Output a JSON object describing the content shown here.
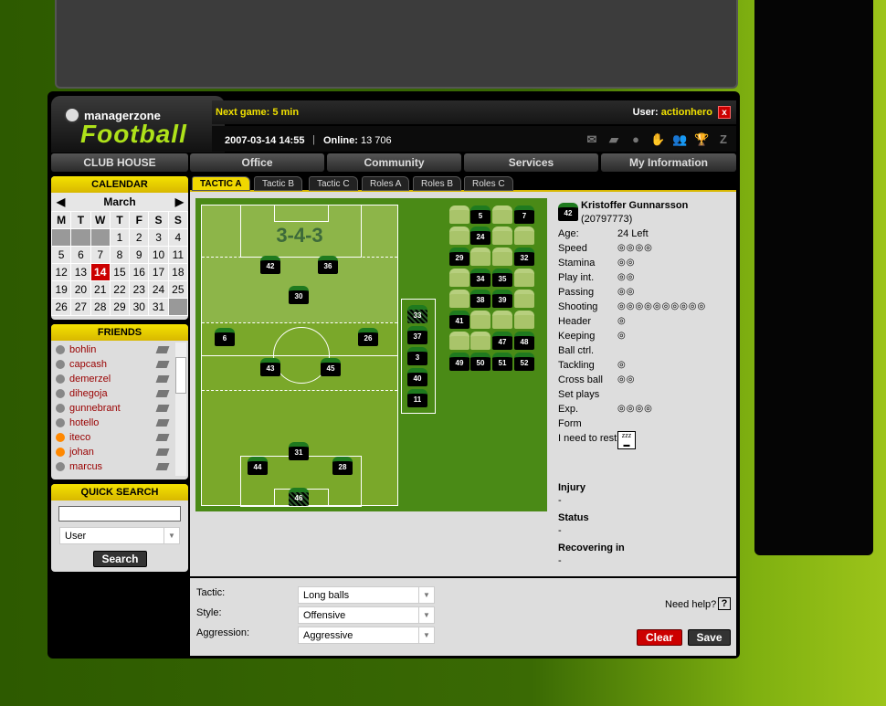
{
  "brand": {
    "top": "managerzone",
    "main": "Football"
  },
  "header": {
    "next_game": "Next game: 5 min",
    "user_label": "User:",
    "username": "actionhero",
    "datetime": "2007-03-14 14:55",
    "online_label": "Online:",
    "online_count": "13 706",
    "icons": [
      "mail-icon",
      "book-icon",
      "ball-icon",
      "hand-icon",
      "people-icon",
      "trophy-icon",
      "z-icon"
    ]
  },
  "nav": [
    "CLUB HOUSE",
    "Office",
    "Community",
    "Services",
    "My Information"
  ],
  "calendar": {
    "title": "CALENDAR",
    "month": "March",
    "weekdays": [
      "M",
      "T",
      "W",
      "T",
      "F",
      "S",
      "S"
    ],
    "weeks": [
      [
        "",
        "",
        "",
        "1",
        "2",
        "3",
        "4"
      ],
      [
        "5",
        "6",
        "7",
        "8",
        "9",
        "10",
        "11"
      ],
      [
        "12",
        "13",
        "14",
        "15",
        "16",
        "17",
        "18"
      ],
      [
        "19",
        "20",
        "21",
        "22",
        "23",
        "24",
        "25"
      ],
      [
        "26",
        "27",
        "28",
        "29",
        "30",
        "31",
        ""
      ]
    ],
    "today": "14"
  },
  "friends": {
    "title": "FRIENDS",
    "items": [
      {
        "name": "bohlin",
        "online": false
      },
      {
        "name": "capcash",
        "online": false
      },
      {
        "name": "demerzel",
        "online": false
      },
      {
        "name": "dihegoja",
        "online": false
      },
      {
        "name": "gunnebrant",
        "online": false
      },
      {
        "name": "hotello",
        "online": false
      },
      {
        "name": "iteco",
        "online": true
      },
      {
        "name": "johan",
        "online": true
      },
      {
        "name": "marcus",
        "online": false
      }
    ]
  },
  "quick_search": {
    "title": "QUICK SEARCH",
    "input_value": "",
    "type": "User",
    "button": "Search"
  },
  "tabs": [
    "TACTIC A",
    "Tactic B",
    "Tactic C",
    "Roles A",
    "Roles B",
    "Roles C"
  ],
  "formation": "3-4-3",
  "field_players": [
    "42",
    "36",
    "30",
    "6",
    "26",
    "43",
    "45",
    "31",
    "44",
    "28",
    "46"
  ],
  "subs": [
    "33",
    "37",
    "3",
    "40",
    "11"
  ],
  "reserves": [
    null,
    "5",
    null,
    "7",
    null,
    "24",
    null,
    null,
    "29",
    null,
    null,
    "32",
    null,
    "34",
    "35",
    null,
    null,
    "38",
    "39",
    null,
    "41",
    null,
    null,
    null,
    null,
    null,
    "47",
    "48",
    "49",
    "50",
    "51",
    "52"
  ],
  "player": {
    "number": "42",
    "name": "Kristoffer Gunnarsson",
    "id": "(20797773)",
    "age_label": "Age:",
    "age": "24 Left",
    "skills": [
      {
        "name": "Speed",
        "balls": 4
      },
      {
        "name": "Stamina",
        "balls": 2
      },
      {
        "name": "Play int.",
        "balls": 2
      },
      {
        "name": "Passing",
        "balls": 2
      },
      {
        "name": "Shooting",
        "balls": 10
      },
      {
        "name": "Header",
        "balls": 1
      },
      {
        "name": "Keeping",
        "balls": 1
      },
      {
        "name": "Ball ctrl.",
        "balls": 0
      },
      {
        "name": "Tackling",
        "balls": 1
      },
      {
        "name": "Cross ball",
        "balls": 2
      },
      {
        "name": "Set plays",
        "balls": 0
      },
      {
        "name": "Exp.",
        "balls": 4
      },
      {
        "name": "Form",
        "balls": 0
      }
    ],
    "rest_label": "I need to rest",
    "injury_label": "Injury",
    "injury": "-",
    "status_label": "Status",
    "status": "-",
    "recovering_label": "Recovering in",
    "recovering": "-"
  },
  "settings": {
    "tactic_label": "Tactic:",
    "tactic": "Long balls",
    "style_label": "Style:",
    "style": "Offensive",
    "aggression_label": "Aggression:",
    "aggression": "Aggressive",
    "help": "Need help?",
    "help_icon": "?",
    "clear": "Clear",
    "save": "Save"
  },
  "colors": {
    "accent": "#f0d800",
    "clear": "#c00000",
    "friend": "#990000"
  }
}
